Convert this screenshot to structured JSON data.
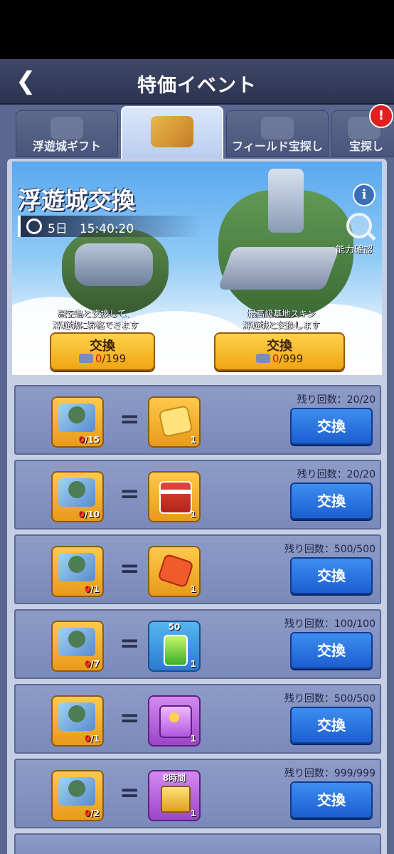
{
  "header": {
    "title": "特価イベント",
    "back_symbol": "❮"
  },
  "tabs": [
    {
      "label": "浮遊城ギフト",
      "active": false
    },
    {
      "label": "",
      "active": true
    },
    {
      "label": "フィールド宝探し",
      "active": false
    },
    {
      "label": "宝探し",
      "active": false
    }
  ],
  "alert_symbol": "!",
  "banner": {
    "title": "浮遊城交換",
    "timer": "5日　15:40:20",
    "info_symbol": "i",
    "ability_label": "能力確認",
    "left": {
      "desc_line1": "飛空島と交換して、",
      "desc_line2": "浮遊城に昇格できます",
      "button_label": "交換",
      "owned": "0",
      "required": "/199"
    },
    "right": {
      "desc_line1": "最高級基地スキン",
      "desc_line2": "浮遊城と交換します",
      "button_label": "交換",
      "owned": "0",
      "required": "/999"
    }
  },
  "rows": [
    {
      "cost_owned": "0",
      "cost_required": "/15",
      "equals": "=",
      "reward": "puzzle-piece-gold",
      "reward_top": "",
      "reward_qty": "1",
      "remaining": "残り回数：20/20",
      "button": "交換"
    },
    {
      "cost_owned": "0",
      "cost_required": "/10",
      "equals": "=",
      "reward": "red-gift-box",
      "reward_top": "",
      "reward_qty": "1",
      "remaining": "残り回数：20/20",
      "button": "交換"
    },
    {
      "cost_owned": "0",
      "cost_required": "/1",
      "equals": "=",
      "reward": "puzzle-piece-red",
      "reward_top": "",
      "reward_qty": "1",
      "remaining": "残り回数：500/500",
      "button": "交換"
    },
    {
      "cost_owned": "0",
      "cost_required": "/7",
      "equals": "=",
      "reward": "energy-battery",
      "reward_top": "50",
      "reward_qty": "1",
      "remaining": "残り回数：100/100",
      "button": "交換"
    },
    {
      "cost_owned": "0",
      "cost_required": "/1",
      "equals": "=",
      "reward": "purple-chest",
      "reward_top": "",
      "reward_qty": "1",
      "remaining": "残り回数：500/500",
      "button": "交換"
    },
    {
      "cost_owned": "0",
      "cost_required": "/2",
      "equals": "=",
      "reward": "purple-time-book",
      "reward_top": "8時間",
      "reward_qty": "1",
      "remaining": "残り回数：999/999",
      "button": "交換"
    }
  ]
}
